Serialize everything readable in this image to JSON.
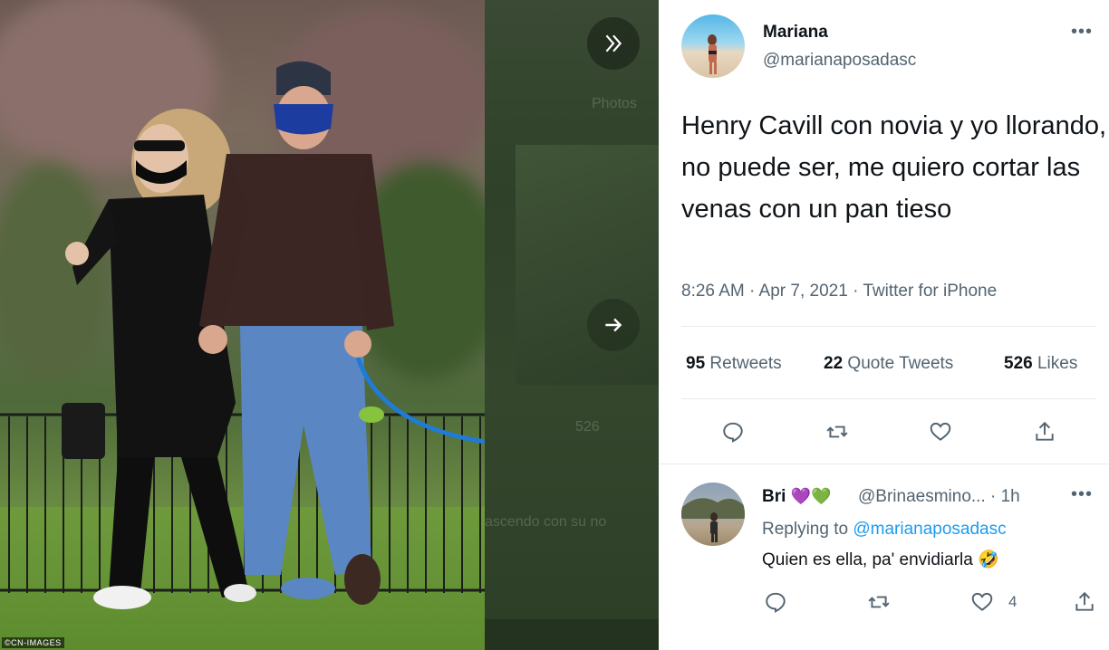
{
  "photo": {
    "credit": "©CN-IMAGES"
  },
  "middle_panel": {
    "ghost_label_top": "Photos",
    "ghost_label_bottom": "ascendo con su no",
    "ghost_count": "526"
  },
  "tweet": {
    "author_name": "Mariana",
    "author_handle": "@marianaposadasc",
    "more": "•••",
    "text": "Henry Cavill con novia y yo llorando, no puede ser, me quiero cortar las venas con un pan tieso",
    "timestamp": "8:26 AM · Apr 7, 2021 · Twitter for iPhone",
    "stats": {
      "retweets_count": "95",
      "retweets_label": "Retweets",
      "quotes_count": "22",
      "quotes_label": "Quote Tweets",
      "likes_count": "526",
      "likes_label": "Likes"
    },
    "actions": [
      "reply",
      "retweet",
      "like",
      "share"
    ]
  },
  "reply": {
    "name": "Bri",
    "handle_time": "@Brinaesmino... · 1h",
    "replying_prefix": "Replying to",
    "replying_to": "@marianaposadasc",
    "text": "Quien es ella, pa' envidiarla",
    "emoji": "🤣",
    "hearts": [
      "💜",
      "💚"
    ],
    "like_count": "4",
    "more": "•••"
  },
  "colors": {
    "link": "#1d9bf0",
    "secondary_text": "#536471",
    "divider": "#e6ecf0"
  }
}
